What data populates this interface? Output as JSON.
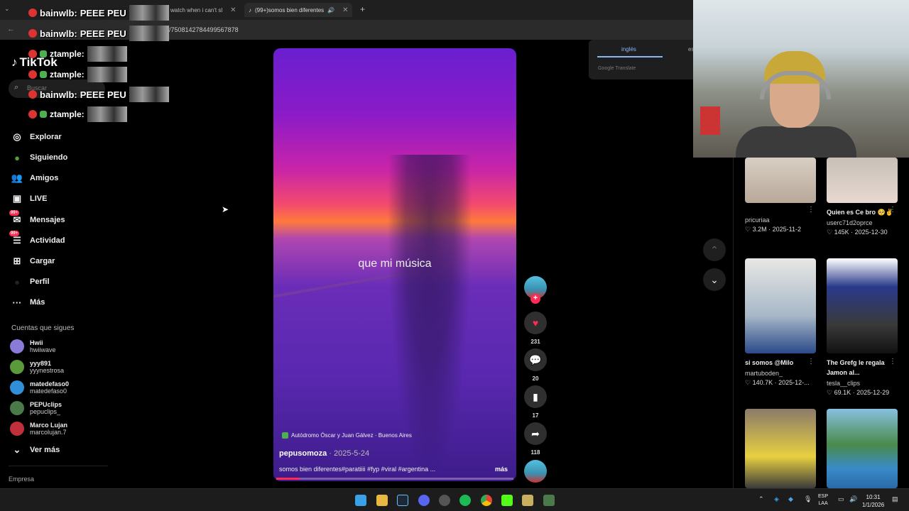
{
  "browser": {
    "tabs": [
      {
        "label": "i watch when i can't sl"
      },
      {
        "label": "(99+)somos bien diferentes"
      }
    ],
    "new_tab": "+",
    "url": "/7508142784499567878"
  },
  "chat": [
    {
      "user": "bainwlb:",
      "msg": "PEEE PEU"
    },
    {
      "user": "bainwlb:",
      "msg": "PEEE PEU"
    },
    {
      "user": "ztample:",
      "msg": ""
    },
    {
      "user": "ztample:",
      "msg": ""
    },
    {
      "user": "bainwlb:",
      "msg": "PEEE PEU"
    },
    {
      "user": "ztample:",
      "msg": ""
    }
  ],
  "sidebar": {
    "logo": "TikTok",
    "search_placeholder": "Buscar",
    "nav": [
      {
        "label": "Explorar",
        "icon": "compass-icon"
      },
      {
        "label": "Siguiendo",
        "icon": "following-icon"
      },
      {
        "label": "Amigos",
        "icon": "friends-icon"
      },
      {
        "label": "LIVE",
        "icon": "live-icon"
      },
      {
        "label": "Mensajes",
        "icon": "messages-icon",
        "badge": "99+"
      },
      {
        "label": "Actividad",
        "icon": "activity-icon",
        "badge": "99+"
      },
      {
        "label": "Cargar",
        "icon": "upload-icon"
      },
      {
        "label": "Perfil",
        "icon": "profile-icon"
      },
      {
        "label": "Más",
        "icon": "more-icon"
      }
    ],
    "following_title": "Cuentas que sigues",
    "following": [
      {
        "name": "Hwii",
        "handle": "hwiiwave",
        "color": "#8a7bd8"
      },
      {
        "name": "yyy891",
        "handle": "yyynestrosa",
        "color": "#5a9a3a"
      },
      {
        "name": "matedefaso0",
        "handle": "matedefaso0",
        "color": "#2f8fd8"
      },
      {
        "name": "PEPUclips",
        "handle": "pepuclips_",
        "color": "#4a7a4a"
      },
      {
        "name": "Marco Lujan",
        "handle": "marcolujan.7",
        "color": "#c0303a"
      }
    ],
    "see_more": "Ver más",
    "footer": "Empresa"
  },
  "video": {
    "caption": "que mi música",
    "location": "Autódromo Óscar y Juan Gálvez · Buenos Aires",
    "author": "pepusomoza",
    "date": " · 2025-5-24",
    "description": "somos bien diferentes#paratiiii #fyp #viral #argentina ...",
    "more": "más",
    "progress": 0.1
  },
  "actions": {
    "likes": "231",
    "comments": "20",
    "saves": "17",
    "shares": "118"
  },
  "translate": {
    "tab1": "inglés",
    "tab2": "es",
    "footer": "Google Translate"
  },
  "grid": [
    {
      "title": "",
      "user": "pricuriaa",
      "likes": "3.2M",
      "date": "2025-11-2"
    },
    {
      "title": "Quien es Ce bro 🥺✌️",
      "user": "userc71d2oprce",
      "likes": "145K",
      "date": "2025-12-30"
    },
    {
      "title": "si somos @Milo",
      "user": "martuboden_",
      "likes": "140.7K",
      "date": "2025-12-..."
    },
    {
      "title": "The Grefg le regala Jamon al...",
      "user": "tesla__clips",
      "likes": "69.1K",
      "date": "2025-12-29"
    }
  ],
  "taskbar": {
    "lang1": "ESP",
    "lang2": "LAA",
    "time": "10:31",
    "date": "1/1/2026"
  },
  "colors": {
    "accent": "#fe2c55",
    "bg": "#000000"
  }
}
